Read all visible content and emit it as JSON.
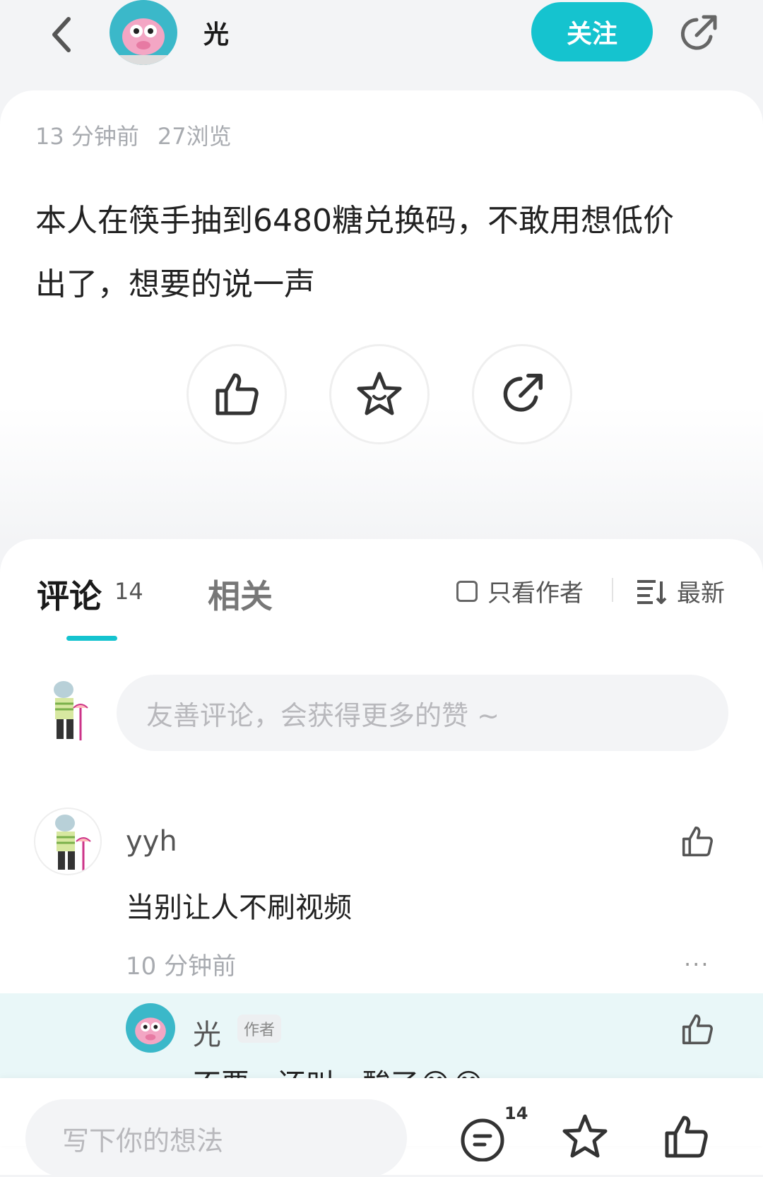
{
  "header": {
    "back_icon": "chevron-left-icon",
    "author_name": "光",
    "follow_label": "关注",
    "share_icon": "share-icon",
    "accent_color": "#15c3cf"
  },
  "post": {
    "time": "13 分钟前",
    "views": "27浏览",
    "body_line1": "本人在筷手抽到6480糖兑换码，不敢用想低价",
    "body_line2": "出了，想要的说一声",
    "actions": [
      "thumbs-up-icon",
      "star-icon",
      "share-icon"
    ]
  },
  "comments_section": {
    "tab_comments": "评论",
    "comment_count": "14",
    "tab_related": "相关",
    "author_only_label": "只看作者",
    "sort_label": "最新",
    "input_placeholder": "友善评论，会获得更多的赞 ~"
  },
  "comments": [
    {
      "user": "yyh",
      "text": "当别让人不刷视频",
      "time": "10 分钟前",
      "more": "···"
    }
  ],
  "reply": {
    "user": "光",
    "badge": "作者",
    "text": "不要，还叫，酸了😂😂"
  },
  "bottom_bar": {
    "placeholder": "写下你的想法",
    "comment_count": "14"
  }
}
